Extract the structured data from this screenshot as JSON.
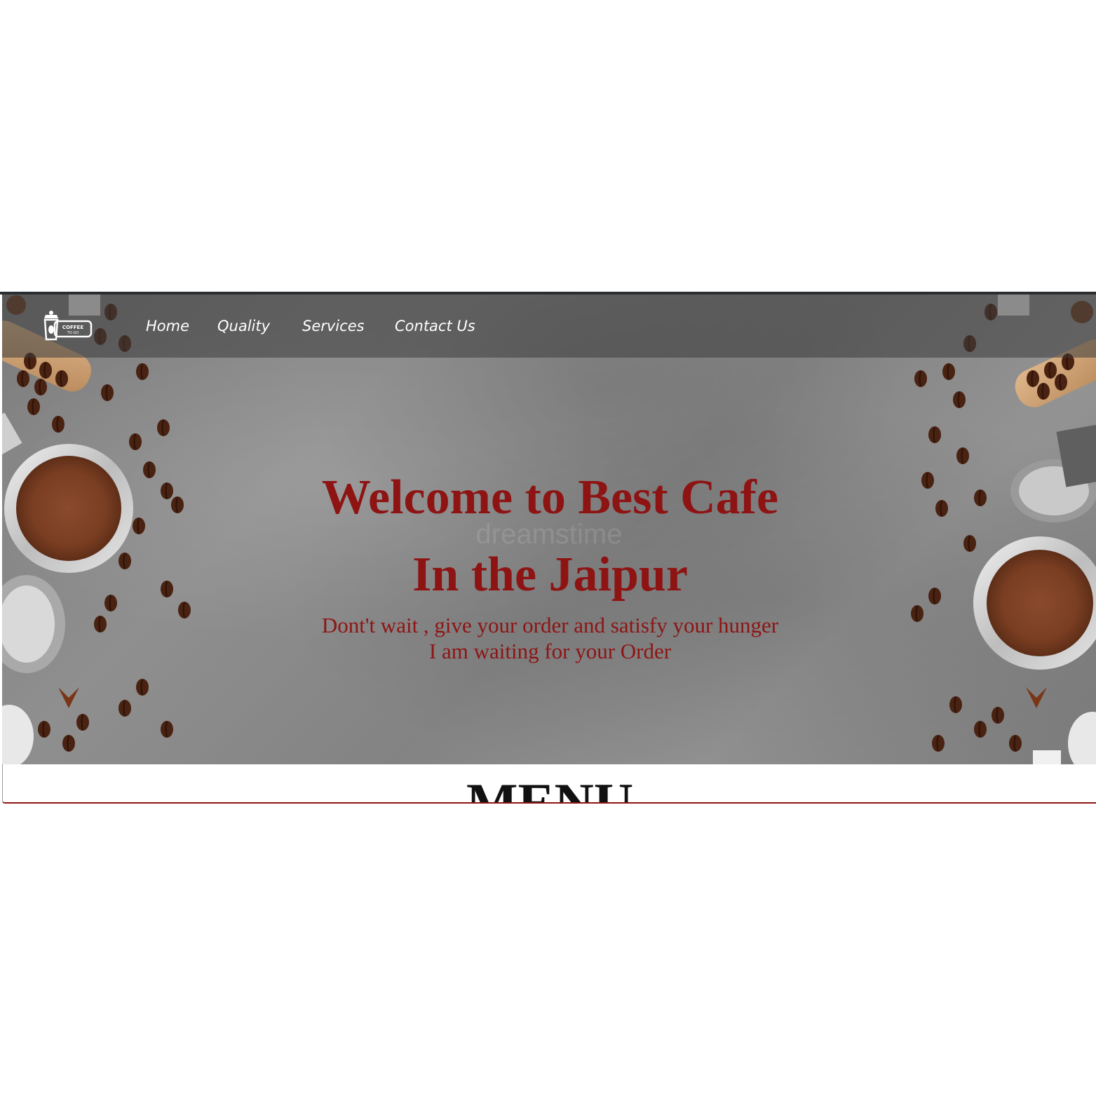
{
  "nav": {
    "logo": {
      "text_line1": "COFFEE",
      "text_line2": "TO GO",
      "icon": "coffee-cup-logo-icon"
    },
    "links": [
      {
        "label": "Home"
      },
      {
        "label": "Quality"
      },
      {
        "label": "Services"
      },
      {
        "label": "Contact Us"
      }
    ]
  },
  "hero": {
    "title_line1": "Welcome to Best Cafe",
    "title_line2": "In the Jaipur",
    "subtitle_line1": "Dont't wait , give your order and satisfy your hunger",
    "subtitle_line2": "I am waiting for your Order",
    "watermark": "dreamstime",
    "background_icon": "coffee-beans-table-background"
  },
  "menu": {
    "heading": "MENU"
  },
  "colors": {
    "accent": "#8e1414",
    "nav_text": "#ffffff",
    "navbar_bg": "#3c3c3c",
    "frame_border": "#2a2e30"
  }
}
